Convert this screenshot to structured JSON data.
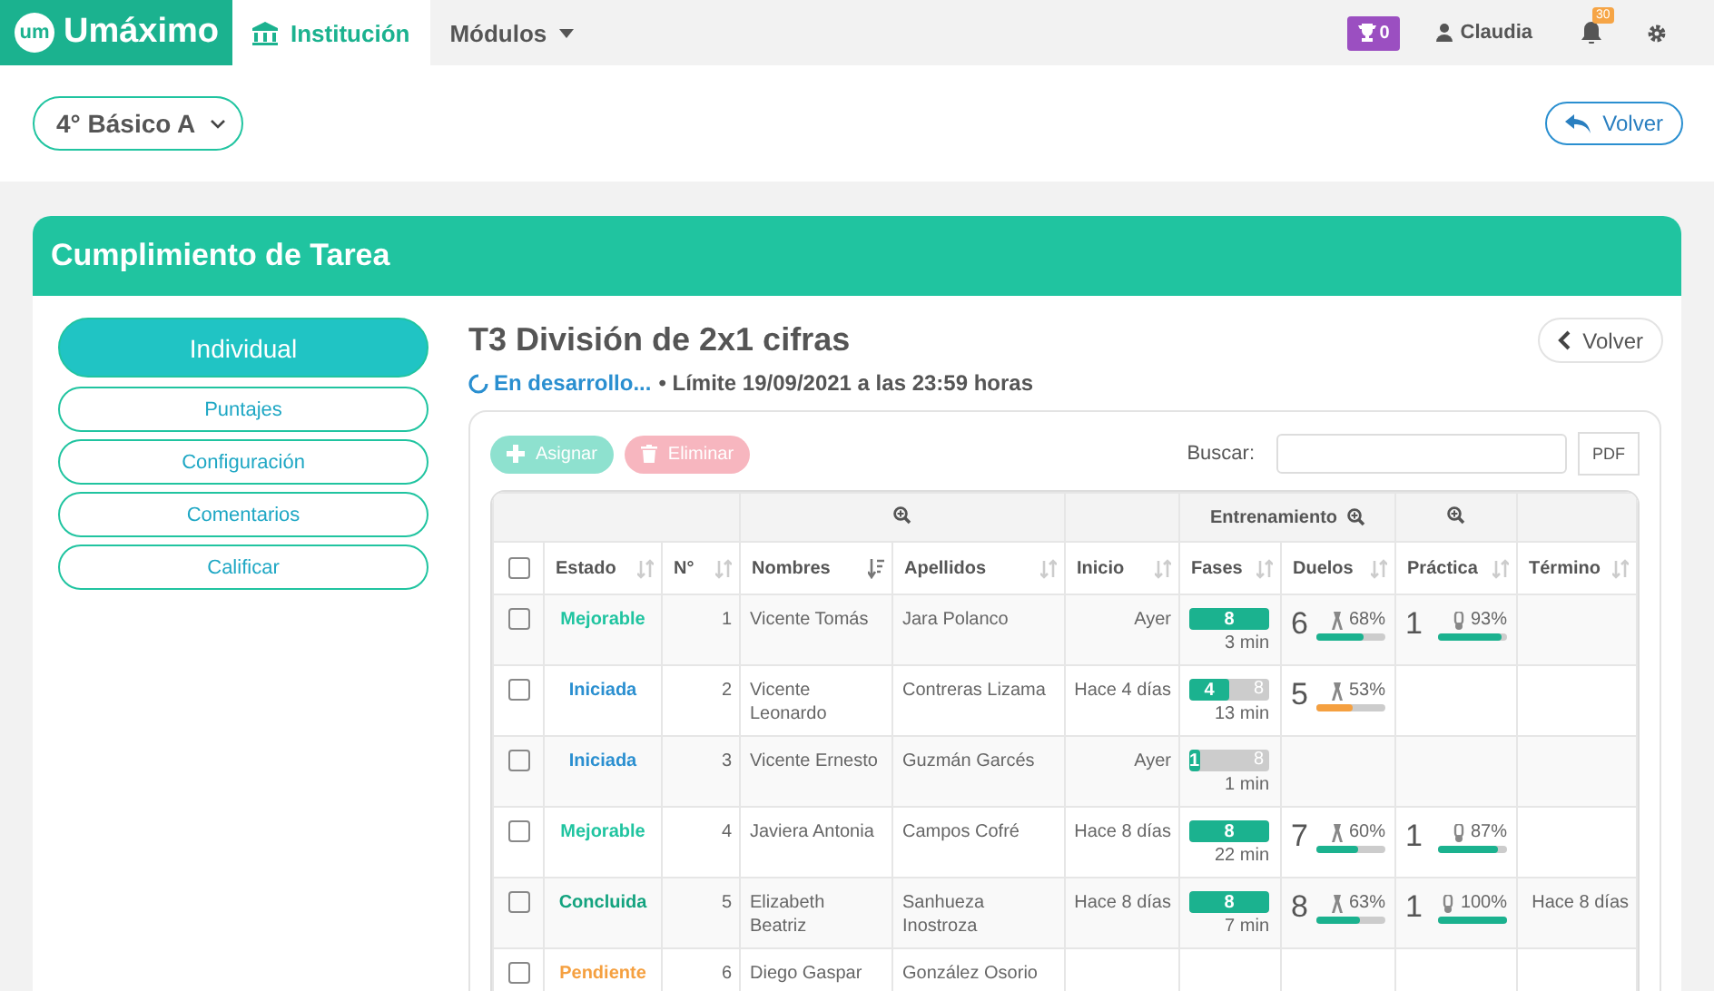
{
  "nav": {
    "logo_mark": "um",
    "brand": "Umáximo",
    "tabs": [
      {
        "label": "Institución",
        "selected": true,
        "kind": "institution"
      },
      {
        "label": "Módulos",
        "selected": false,
        "kind": "dropdown"
      }
    ],
    "trophies": "0",
    "user": "Claudia",
    "notifications": "30"
  },
  "course_select": {
    "value": "4° Básico A"
  },
  "back_button": "Volver",
  "card": {
    "title": "Cumplimiento de Tarea",
    "sidebar": [
      {
        "label": "Individual",
        "selected": true
      },
      {
        "label": "Puntajes",
        "selected": false
      },
      {
        "label": "Configuración",
        "selected": false
      },
      {
        "label": "Comentarios",
        "selected": false
      },
      {
        "label": "Calificar",
        "selected": false
      }
    ],
    "task": {
      "title": "T3 División de 2x1 cifras",
      "status": "En desarrollo...",
      "deadline": "• Límite 19/09/2021 a las 23:59 horas",
      "back_button": "Volver"
    },
    "toolbar": {
      "assign": {
        "label": "Asignar",
        "disabled": true
      },
      "delete": {
        "label": "Eliminar",
        "disabled": true
      },
      "search_label": "Buscar:",
      "pdf": "PDF"
    },
    "table": {
      "group_label": "Entrenamiento",
      "select_all_checked": false,
      "columns": [
        {
          "label": "Estado",
          "sorted": false
        },
        {
          "label": "N°",
          "sorted": false
        },
        {
          "label": "Nombres",
          "sorted": true
        },
        {
          "label": "Apellidos",
          "sorted": false
        },
        {
          "label": "Inicio",
          "sorted": false
        },
        {
          "label": "Fases",
          "sorted": false
        },
        {
          "label": "Duelos",
          "sorted": false
        },
        {
          "label": "Práctica",
          "sorted": false
        },
        {
          "label": "Término",
          "sorted": false
        }
      ],
      "rows": [
        {
          "checked": false,
          "estado": "Mejorable",
          "color": "#20c4a0",
          "n": "1",
          "nombres": "Vicente Tomás",
          "apellidos": "Jara Polanco",
          "inicio": "Ayer",
          "fases": {
            "done": "8",
            "level": 1,
            "time": "3 min"
          },
          "duelos": {
            "count": "6",
            "pct": "68%",
            "level": 0.68,
            "color": "#1bb28f"
          },
          "practica": {
            "count": "1",
            "pct": "93%",
            "level": 0.93
          }
        },
        {
          "checked": false,
          "estado": "Iniciada",
          "color": "#2a8fd0",
          "n": "2",
          "nombres": "Vicente Leonardo",
          "apellidos": "Contreras Lizama",
          "inicio": "Hace 4 días",
          "fases": {
            "done": "4",
            "total": "8",
            "level": 0.5,
            "time": "13 min"
          },
          "duelos": {
            "count": "5",
            "pct": "53%",
            "level": 0.53,
            "color": "#f5a040"
          }
        },
        {
          "checked": false,
          "estado": "Iniciada",
          "color": "#2a8fd0",
          "n": "3",
          "nombres": "Vicente Ernesto",
          "apellidos": "Guzmán Garcés",
          "inicio": "Ayer",
          "fases": {
            "done": "1",
            "total": "8",
            "level": 0.125,
            "time": "1 min"
          }
        },
        {
          "checked": false,
          "estado": "Mejorable",
          "color": "#20c4a0",
          "n": "4",
          "nombres": "Javiera Antonia",
          "apellidos": "Campos Cofré",
          "inicio": "Hace 8 días",
          "fases": {
            "done": "8",
            "level": 1,
            "time": "22 min"
          },
          "duelos": {
            "count": "7",
            "pct": "60%",
            "level": 0.6,
            "color": "#1bb28f"
          },
          "practica": {
            "count": "1",
            "pct": "87%",
            "level": 0.87
          }
        },
        {
          "checked": false,
          "estado": "Concluida",
          "color": "#14a37f",
          "n": "5",
          "nombres": "Elizabeth Beatriz",
          "apellidos": "Sanhueza Inostroza",
          "inicio": "Hace 8 días",
          "fases": {
            "done": "8",
            "level": 1,
            "time": "7 min"
          },
          "duelos": {
            "count": "8",
            "pct": "63%",
            "level": 0.63,
            "color": "#1bb28f"
          },
          "practica": {
            "count": "1",
            "pct": "100%",
            "level": 1
          },
          "termino": "Hace 8 días"
        },
        {
          "checked": false,
          "estado": "Pendiente",
          "color": "#f5a040",
          "n": "6",
          "nombres": "Diego Gaspar",
          "apellidos": "González Osorio"
        }
      ]
    }
  }
}
